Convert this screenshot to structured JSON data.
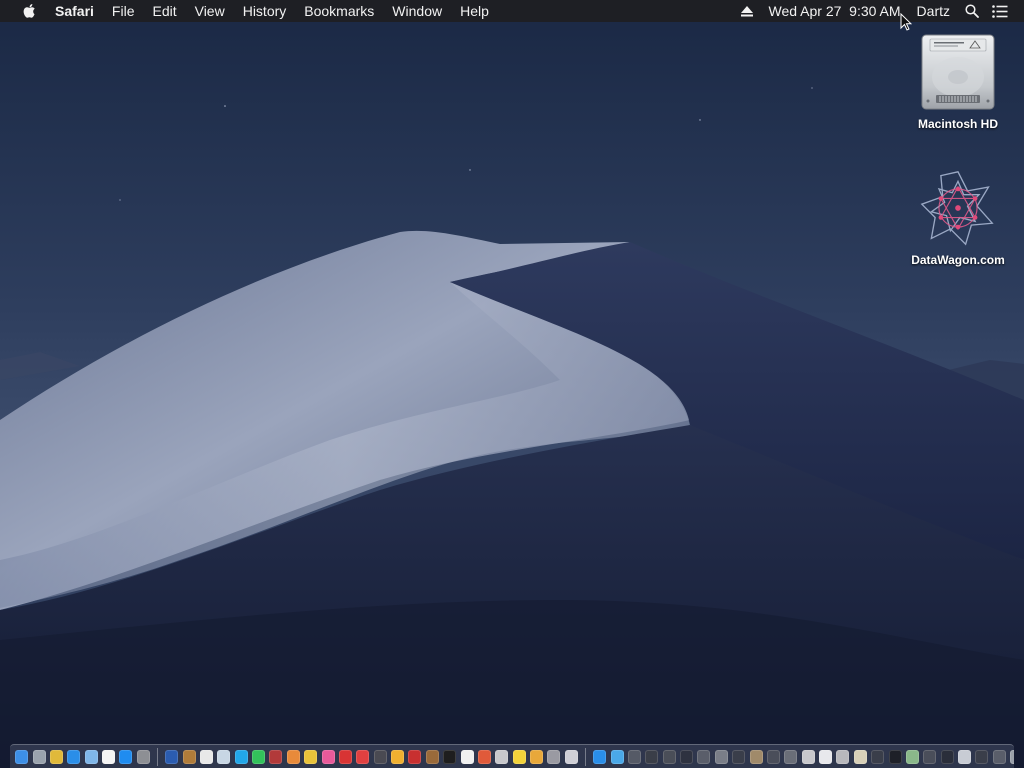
{
  "menubar": {
    "app_name": "Safari",
    "menus": [
      "File",
      "Edit",
      "View",
      "History",
      "Bookmarks",
      "Window",
      "Help"
    ],
    "clock": "Wed Apr 27  9:30 AM",
    "user": "Dartz",
    "icons": [
      "apple-icon",
      "eject-icon",
      "spotlight-search-icon",
      "notification-center-icon"
    ]
  },
  "desktop": {
    "icons": [
      {
        "label": "Macintosh HD",
        "icon": "hard-drive-icon"
      },
      {
        "label": "DataWagon.com",
        "icon": "datawagon-logo-icon"
      }
    ]
  },
  "dock": {
    "apps_left": [
      {
        "name": "finder",
        "color": "#3d8fe6"
      },
      {
        "name": "launchpad",
        "color": "#9aa3ad"
      },
      {
        "name": "chrome",
        "color": "#e0b93a"
      },
      {
        "name": "safari",
        "color": "#2a8ee8"
      },
      {
        "name": "mail",
        "color": "#7fb6e8"
      },
      {
        "name": "calendar",
        "color": "#f4f4f4"
      },
      {
        "name": "app-store",
        "color": "#1f8cf0"
      },
      {
        "name": "system-preferences",
        "color": "#8d8f94"
      }
    ],
    "apps_middle": [
      {
        "name": "word",
        "color": "#2b5cb0"
      },
      {
        "name": "notes-brown",
        "color": "#b07c3a"
      },
      {
        "name": "textedit",
        "color": "#e8e8e8"
      },
      {
        "name": "preview",
        "color": "#c8d6e4"
      },
      {
        "name": "skype",
        "color": "#22a6e8"
      },
      {
        "name": "messages",
        "color": "#33c25b"
      },
      {
        "name": "calculator-red",
        "color": "#b23a3a"
      },
      {
        "name": "photos",
        "color": "#e88a3a"
      },
      {
        "name": "folder-yellow",
        "color": "#e8c23a"
      },
      {
        "name": "itunes",
        "color": "#e85a9a"
      },
      {
        "name": "red-app",
        "color": "#d83434"
      },
      {
        "name": "no-entry",
        "color": "#e04040"
      },
      {
        "name": "dark-tool",
        "color": "#4a4a52"
      },
      {
        "name": "emoji",
        "color": "#f0b030"
      },
      {
        "name": "red-doc",
        "color": "#c83030"
      },
      {
        "name": "brown-box",
        "color": "#9a6a3a"
      },
      {
        "name": "terminal",
        "color": "#1e1e1e"
      },
      {
        "name": "white-doc",
        "color": "#f0f0f0"
      },
      {
        "name": "cube",
        "color": "#e05a3a"
      },
      {
        "name": "document-grey",
        "color": "#c8c8cc"
      },
      {
        "name": "note-yellow",
        "color": "#f2d23a"
      },
      {
        "name": "image-capture",
        "color": "#e8a83a"
      },
      {
        "name": "grey-app",
        "color": "#9a9aa2"
      },
      {
        "name": "script-editor",
        "color": "#cfcfd6"
      }
    ],
    "apps_right": [
      {
        "name": "app-store-right",
        "color": "#2a8ee8"
      },
      {
        "name": "folder-blue",
        "color": "#4aa8e8"
      },
      {
        "name": "win-1",
        "color": "#555a66"
      },
      {
        "name": "win-2",
        "color": "#3a3e48"
      },
      {
        "name": "win-3",
        "color": "#4a4e58"
      },
      {
        "name": "win-4",
        "color": "#2e3240"
      },
      {
        "name": "win-5",
        "color": "#5a5e6a"
      },
      {
        "name": "win-6",
        "color": "#7a7e88"
      },
      {
        "name": "win-7",
        "color": "#3a3e4a"
      },
      {
        "name": "win-8",
        "color": "#a08a6a"
      },
      {
        "name": "win-9",
        "color": "#4a4e5a"
      },
      {
        "name": "win-10",
        "color": "#6a6e78"
      },
      {
        "name": "win-11",
        "color": "#c8c8cc"
      },
      {
        "name": "win-12",
        "color": "#e8e8ec"
      },
      {
        "name": "win-13",
        "color": "#b8b8bc"
      },
      {
        "name": "win-14",
        "color": "#d8d0b8"
      },
      {
        "name": "win-15",
        "color": "#3a3e4a"
      },
      {
        "name": "win-16",
        "color": "#1e2028"
      },
      {
        "name": "win-17",
        "color": "#8ab88a"
      },
      {
        "name": "win-18",
        "color": "#4a4e5a"
      },
      {
        "name": "win-19",
        "color": "#2a2e3a"
      },
      {
        "name": "win-20",
        "color": "#c8ccd4"
      },
      {
        "name": "win-21",
        "color": "#3a3e4a"
      },
      {
        "name": "win-22",
        "color": "#5a5e6a"
      },
      {
        "name": "trash",
        "color": "#9aa0aa"
      }
    ]
  }
}
